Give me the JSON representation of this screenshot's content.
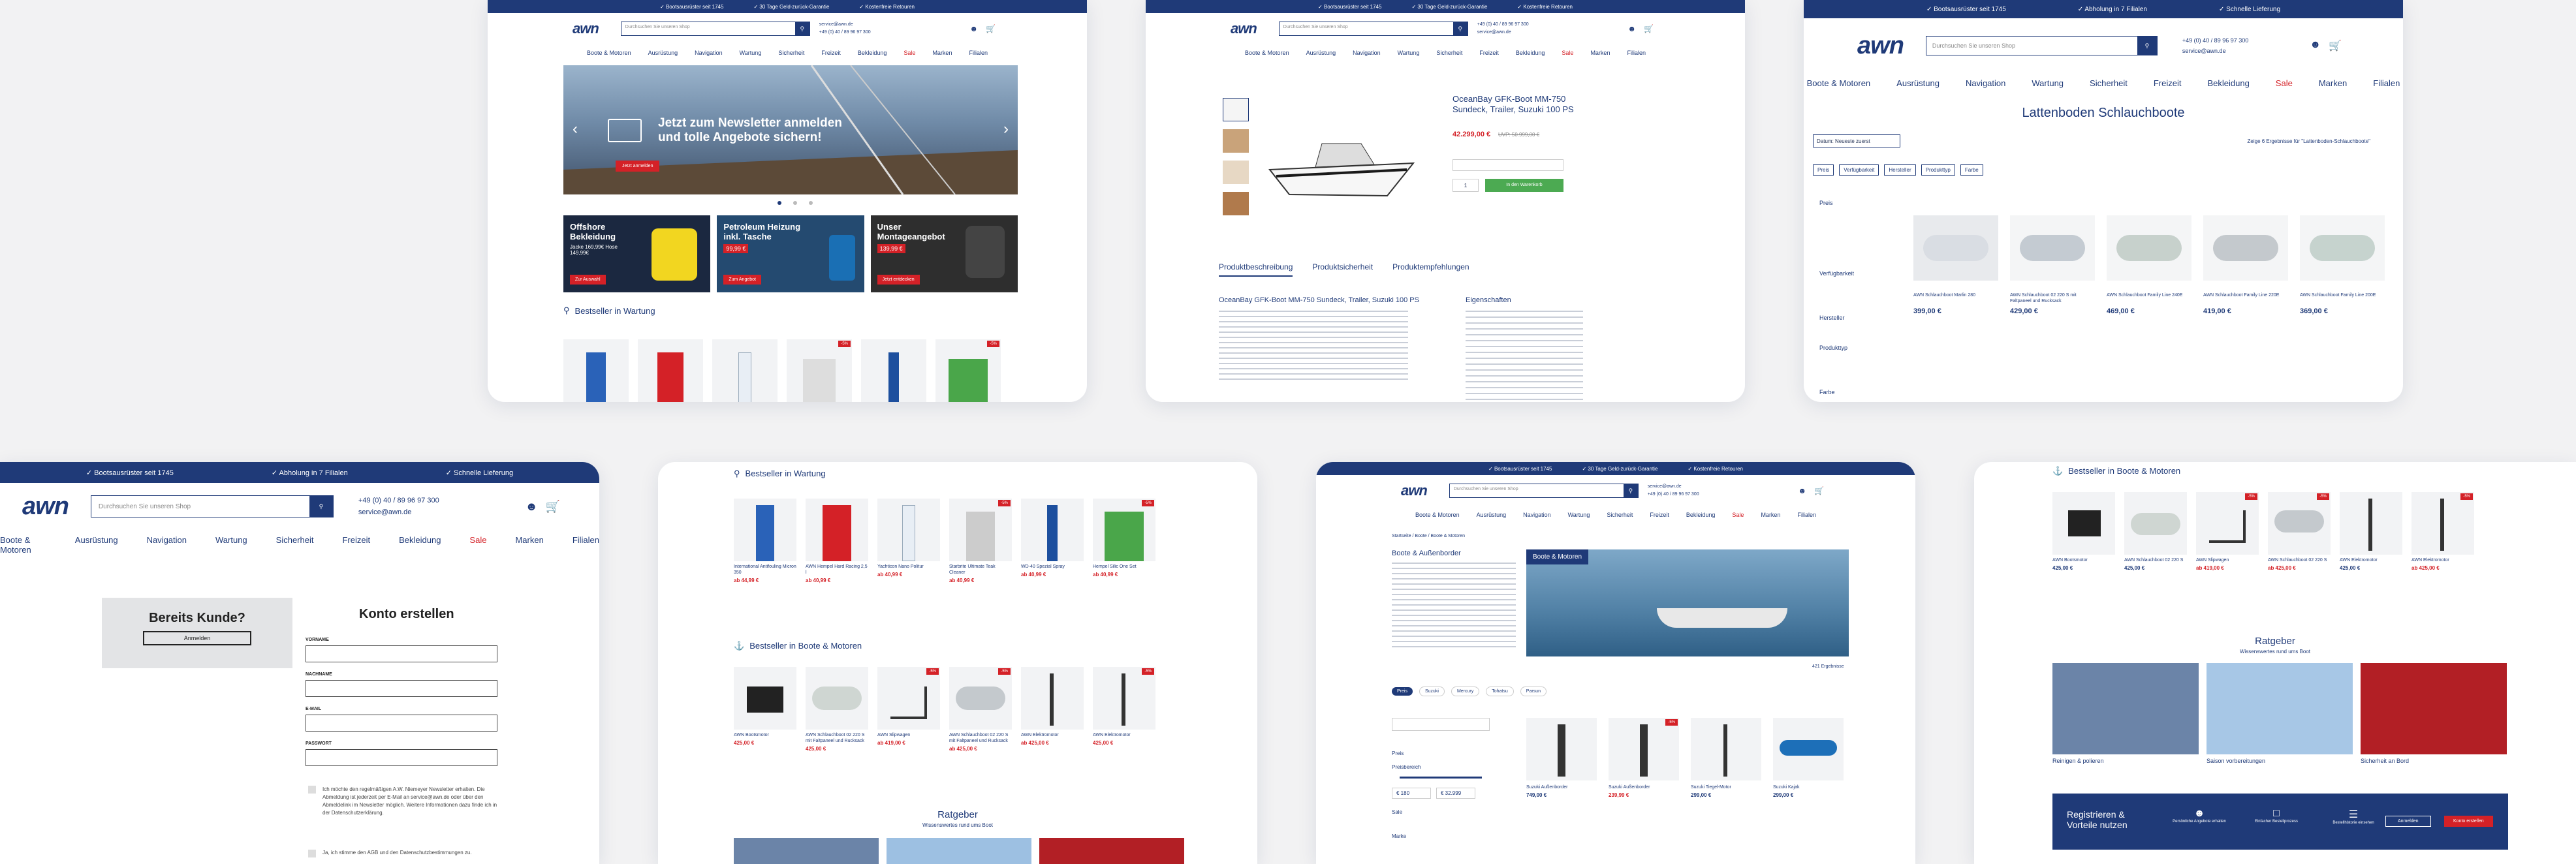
{
  "usp": [
    "Bootsausrüster seit 1745",
    "Abholung in 7 Filialen",
    "Schnelle Lieferung"
  ],
  "usp_alt": [
    "Bootsausrüster seit 1745",
    "30 Tage Geld-zurück-Garantie",
    "Kostenfreie Retouren"
  ],
  "logo": "awn",
  "search_placeholder": "Durchsuchen Sie unseren Shop",
  "contact": {
    "phone": "+49 (0) 40 / 89 96 97 300",
    "email": "service@awn.de"
  },
  "nav": [
    "Boote & Motoren",
    "Ausrüstung",
    "Navigation",
    "Wartung",
    "Sicherheit",
    "Freizeit",
    "Bekleidung",
    "Sale",
    "Marken",
    "Filialen"
  ],
  "home": {
    "hero_title": "Jetzt zum Newsletter anmelden und tolle Angebote sichern!",
    "hero_button": "Jetzt anmelden",
    "promos": [
      {
        "title": "Offshore Bekleidung",
        "sub": "Jacke 169,99€ Hose 149,99€",
        "btn": "Zur Auswahl"
      },
      {
        "title": "Petroleum Heizung inkl. Tasche",
        "sub": "99,99 €",
        "btn": "Zum Angebot"
      },
      {
        "title": "Unser Montageangebot",
        "sub": "139,99 €",
        "btn": "Jetzt entdecken"
      }
    ],
    "bestseller": "Bestseller in Wartung"
  },
  "pdp": {
    "title": "OceanBay GFK-Boot MM-750 Sundeck, Trailer, Suzuki 100 PS",
    "price": "42.299,00 €",
    "old_price": "UVP: 50.999,00 €",
    "cart": "In den Warenkorb",
    "tabs": [
      "Produktbeschreibung",
      "Produktsicherheit",
      "Produktempfehlungen"
    ],
    "desc_title": "OceanBay GFK-Boot MM-750 Sundeck, Trailer, Suzuki 100 PS",
    "props": "Eigenschaften"
  },
  "category": {
    "title": "Lattenboden Schlauchboote",
    "sort": "Datum: Neueste zuerst",
    "count": "Zeige 6 Ergebnisse für \"Lattenboden-Schlauchboote\"",
    "filters": [
      "Preis",
      "Verfügbarkeit",
      "Hersteller",
      "Produkttyp",
      "Farbe"
    ],
    "side": [
      "Preis",
      "Verfügbarkeit",
      "Hersteller",
      "Produkttyp",
      "Farbe"
    ],
    "products": [
      {
        "name": "AWN Schlauchboot Marlin 280",
        "price": "399,00 €"
      },
      {
        "name": "AWN Schlauchboot 02 220 S mit Faltpaneel und Rucksack",
        "price": "429,00 €"
      },
      {
        "name": "AWN Schlauchboot Family Line 240E",
        "price": "469,00 €"
      },
      {
        "name": "AWN Schlauchboot Family Line 220E",
        "price": "419,00 €"
      },
      {
        "name": "AWN Schlauchboot Family Line 200E",
        "price": "369,00 €"
      }
    ]
  },
  "register": {
    "customer": "Bereits Kunde?",
    "login": "Anmelden",
    "title": "Konto erstellen",
    "fields": [
      "VORNAME",
      "NACHNAME",
      "E-MAIL",
      "PASSWORT"
    ],
    "newsletter": "Ich möchte den regelmäßigen A.W. Niemeyer Newsletter erhalten. Die Abmeldung ist jederzeit per E-Mail an service@awn.de oder über den Abmeldelink im Newsletter möglich. Weitere Informationen dazu finde ich in der Datenschutzerklärung.",
    "agb": "Ja, ich stimme den AGB und den Datenschutzbestimmungen zu."
  },
  "bests": {
    "wartung": "Bestseller in Wartung",
    "boote": "Bestseller in Boote & Motoren",
    "ratgeber": "Ratgeber",
    "ratgeber_sub": "Wissenswertes rund ums Boot",
    "wartung_items": [
      {
        "name": "International Antifouling Micron 350",
        "price": "ab 44,99 €"
      },
      {
        "name": "AWN Hempel Hard Racing 2,5 l",
        "price": "ab 40,99 €"
      },
      {
        "name": "Yachticon Nano Politur",
        "price": "ab 40,99 €"
      },
      {
        "name": "Starbrite Ultimate Teak Cleaner",
        "price": "ab 40,99 €"
      },
      {
        "name": "WD-40 Spezial Spray",
        "price": "ab 40,99 €"
      },
      {
        "name": "Hempel Silic One Set",
        "price": "ab 40,99 €"
      }
    ],
    "boote_items": [
      {
        "name": "AWN Bootsmotor",
        "price": "425,00 €"
      },
      {
        "name": "AWN Schlauchboot 02 220 S mit Faltpaneel und Rucksack",
        "price": "425,00 €"
      },
      {
        "name": "AWN Slipwagen",
        "price": "ab 419,00 €"
      },
      {
        "name": "AWN Schlauchboot 02 220 S mit Faltpaneel und Rucksack",
        "price": "ab 425,00 €"
      },
      {
        "name": "AWN Elektromotor",
        "price": "ab 425,00 €"
      },
      {
        "name": "AWN Elektromotor",
        "price": "425,00 €"
      }
    ]
  },
  "boote": {
    "breadcrumb": "Startseite / Boote / Boote & Motoren",
    "title": "Boote & Außenborder",
    "hero_label": "Boote & Motoren",
    "count": "421 Ergebnisse",
    "filter_tags": [
      "Preis",
      "Suzuki",
      "Mercury",
      "Tohatsu",
      "Parsun"
    ],
    "side": [
      "Preis",
      "Preisbereich",
      "Sale",
      "Marke"
    ],
    "price_min": "€ 180",
    "price_max": "€ 32.999",
    "products": [
      {
        "name": "Suzuki Außenborder",
        "price": "749,00 €"
      },
      {
        "name": "Suzuki Außenborder",
        "price": "239,99 €"
      },
      {
        "name": "Suzuki Tiegel-Motor",
        "price": "299,00 €"
      },
      {
        "name": "Suzuki Kajak",
        "price": "299,00 €"
      }
    ]
  },
  "right": {
    "bestseller": "Bestseller in Boote & Motoren",
    "ratgeber": "Ratgeber",
    "ratgeber_sub": "Wissenswertes rund ums Boot",
    "ratgeber_items": [
      "Reinigen & polieren",
      "Saison vorbereitungen",
      "Sicherheit an Bord"
    ],
    "banner_title": "Registrieren & Vorteile nutzen",
    "banner_benefits": [
      "Persönliche Angebote erhalten",
      "Einfacher Bestellprozess",
      "Bestellhistorie einsehen"
    ],
    "banner_btn1": "Anmelden",
    "banner_btn2": "Konto erstellen",
    "items": [
      {
        "name": "AWN Bootsmotor",
        "price": "425,00 €"
      },
      {
        "name": "AWN Schlauchboot 02 220 S",
        "price": "425,00 €"
      },
      {
        "name": "AWN Slipwagen",
        "price": "ab 419,00 €"
      },
      {
        "name": "AWN Schlauchboot 02 220 S",
        "price": "ab 425,00 €"
      },
      {
        "name": "AWN Elektromotor",
        "price": "425,00 €"
      },
      {
        "name": "AWN Elektromotor",
        "price": "ab 425,00 €"
      }
    ]
  }
}
